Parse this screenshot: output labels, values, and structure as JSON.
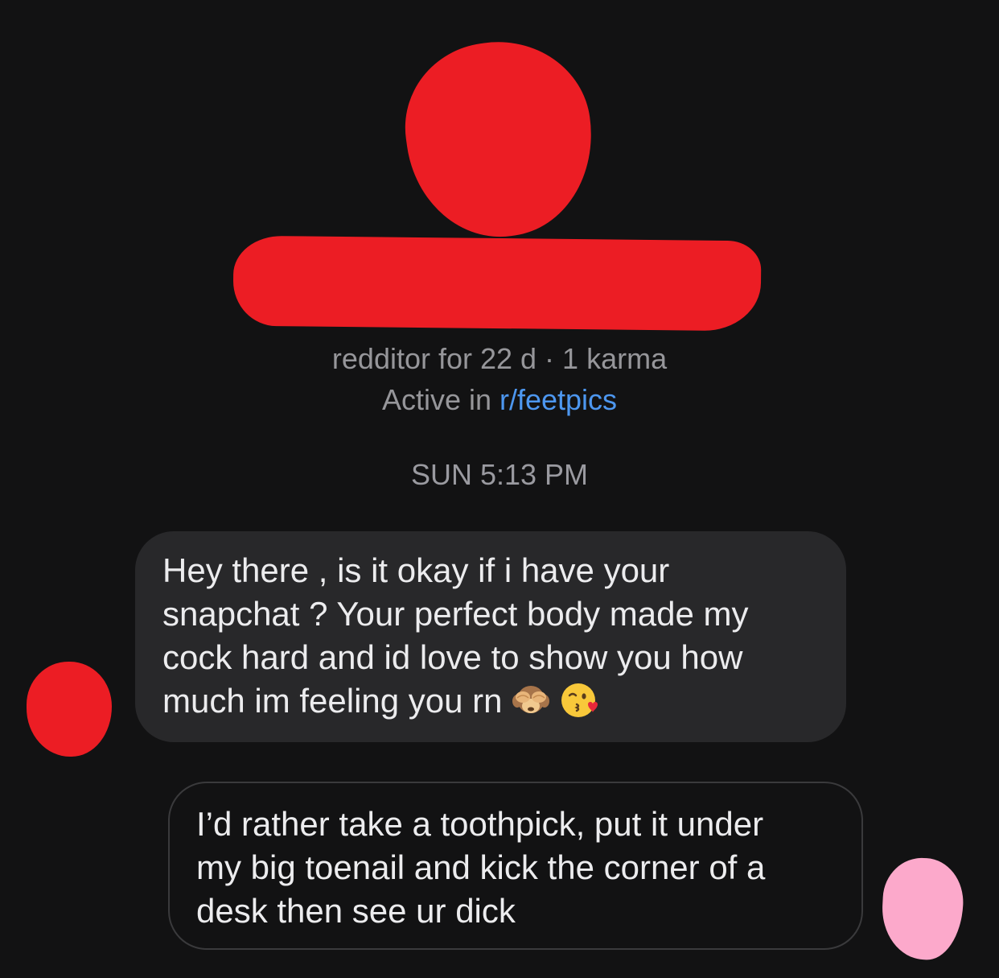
{
  "profile": {
    "meta_line_1": "redditor for 22 d · 1 karma",
    "active_prefix": "Active in ",
    "active_subreddit": "r/feetpics"
  },
  "conversation": {
    "timestamp": "SUN 5:13 PM",
    "messages": [
      {
        "direction": "incoming",
        "lines": [
          "Hey there , is it okay if i have your",
          "snapchat ? Your perfect body made my",
          "cock hard and id love to show you how",
          "much im feeling you rn"
        ],
        "emoji": [
          "see-no-evil-monkey-icon",
          "face-blowing-kiss-icon"
        ]
      },
      {
        "direction": "outgoing",
        "lines": [
          "I’d rather take a toothpick, put it under",
          "my big toenail and kick the corner of a",
          "desk then see ur dick"
        ]
      }
    ]
  },
  "colors": {
    "background": "#121213",
    "incoming_bubble": "#28282a",
    "outgoing_bubble_border": "#3a3a3c",
    "link": "#4d97f0",
    "meta_text": "#96969a",
    "redaction_red": "#ec1d24",
    "redaction_pink": "#fca9cb"
  }
}
